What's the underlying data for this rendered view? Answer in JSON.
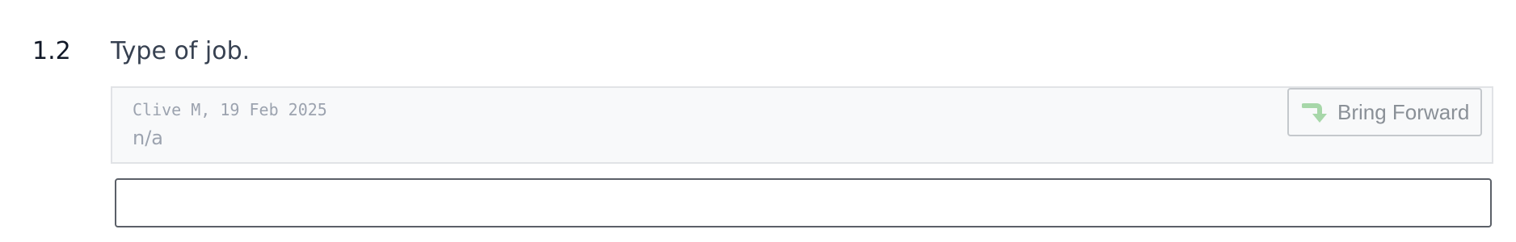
{
  "question": {
    "number": "1.2",
    "text": "Type of job."
  },
  "previous_answer": {
    "meta": "Clive M, 19 Feb 2025",
    "value": "n/a"
  },
  "bring_forward": {
    "label": "Bring Forward",
    "icon": "arrow-turn-down-right-icon",
    "icon_color": "#a7d7a9"
  },
  "answer_input": {
    "value": "",
    "placeholder": ""
  }
}
